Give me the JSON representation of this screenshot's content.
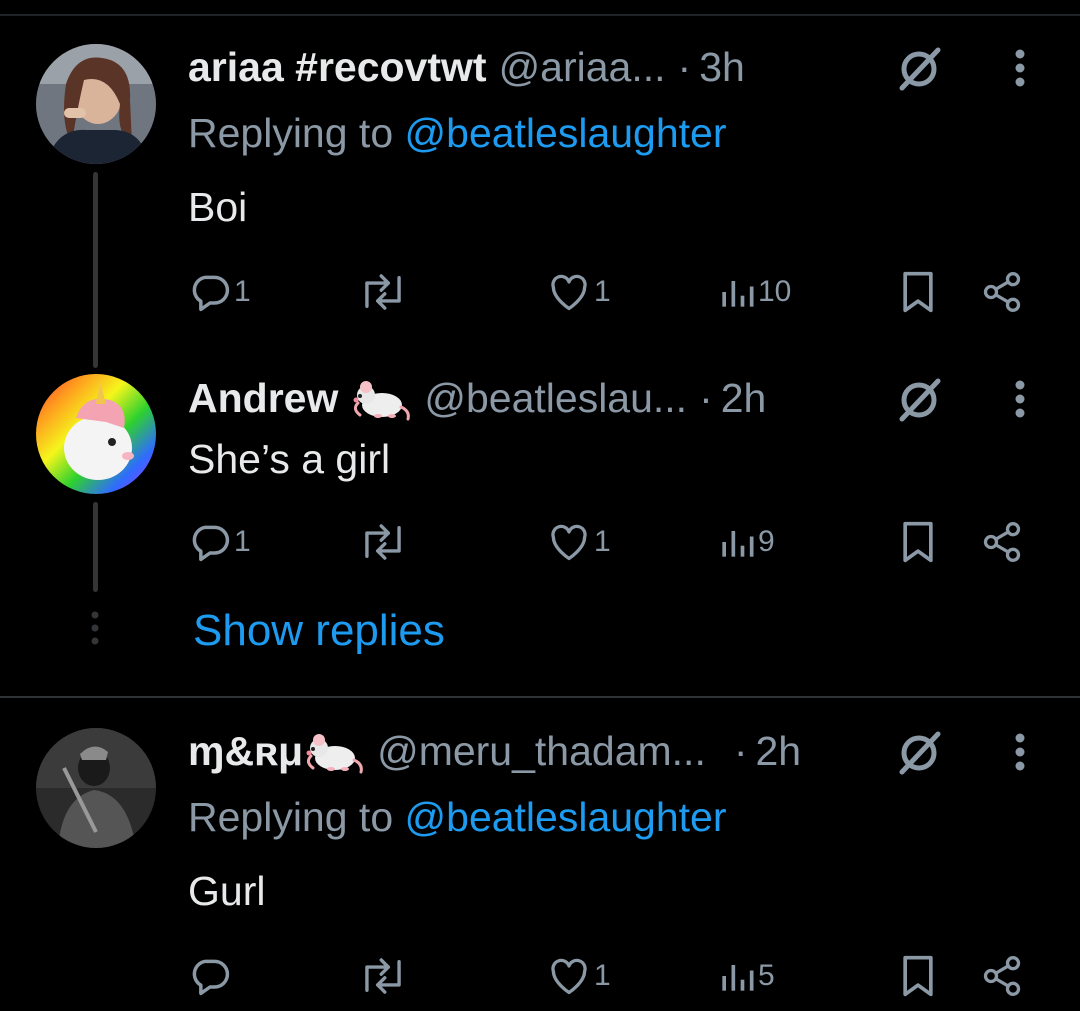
{
  "colors": {
    "background": "#000000",
    "primary_text": "#e7e9ea",
    "secondary_text": "#8b98a5",
    "accent_link": "#1d9bf0",
    "divider": "#2f3336"
  },
  "tweets": [
    {
      "name": "ariaa #recovtwt",
      "handle": "@ariaa...",
      "dot": "·",
      "time": "3h",
      "replying_prefix": "Replying to ",
      "replying_to": "@beatleslaughter",
      "text": "Boi",
      "replies": "1",
      "retweets": "",
      "likes": "1",
      "views": "10",
      "avatar_icon": "avatar-photo",
      "badge_icon": ""
    },
    {
      "name": "Andrew",
      "handle": "@beatleslau...",
      "dot": "·",
      "time": "2h",
      "replying_prefix": "",
      "replying_to": "",
      "text": "She’s a girl",
      "replies": "1",
      "retweets": "",
      "likes": "1",
      "views": "9",
      "avatar_icon": "unicorn-rainbow-avatar",
      "badge_icon": "rat-emoji"
    },
    {
      "name": "ɱ&ʀμ",
      "handle": "@meru_thadam...",
      "dot": "·",
      "time": "2h",
      "replying_prefix": "Replying to ",
      "replying_to": "@beatleslaughter",
      "text": "Gurl",
      "replies": "",
      "retweets": "",
      "likes": "1",
      "views": "5",
      "avatar_icon": "avatar-photo-grayscale",
      "badge_icon": "rat-emoji"
    }
  ],
  "show_replies_label": "Show replies"
}
